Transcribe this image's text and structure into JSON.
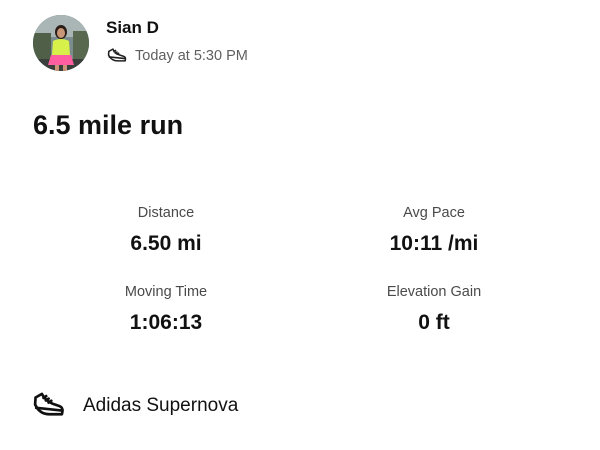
{
  "athlete": {
    "name": "Sian D",
    "avatar_icon": "athlete-photo"
  },
  "activity": {
    "sport_icon": "running-shoe-icon",
    "timestamp": "Today at 5:30 PM",
    "title": "6.5 mile run"
  },
  "stats": {
    "distance": {
      "label": "Distance",
      "value": "6.50 mi"
    },
    "avg_pace": {
      "label": "Avg Pace",
      "value": "10:11 /mi"
    },
    "moving_time": {
      "label": "Moving Time",
      "value": "1:06:13"
    },
    "elevation_gain": {
      "label": "Elevation Gain",
      "value": "0 ft"
    }
  },
  "gear": {
    "icon": "running-shoe-icon",
    "name": "Adidas Supernova"
  },
  "colors": {
    "text_primary": "#111111",
    "text_secondary": "#5f5f5f",
    "background": "#ffffff"
  }
}
